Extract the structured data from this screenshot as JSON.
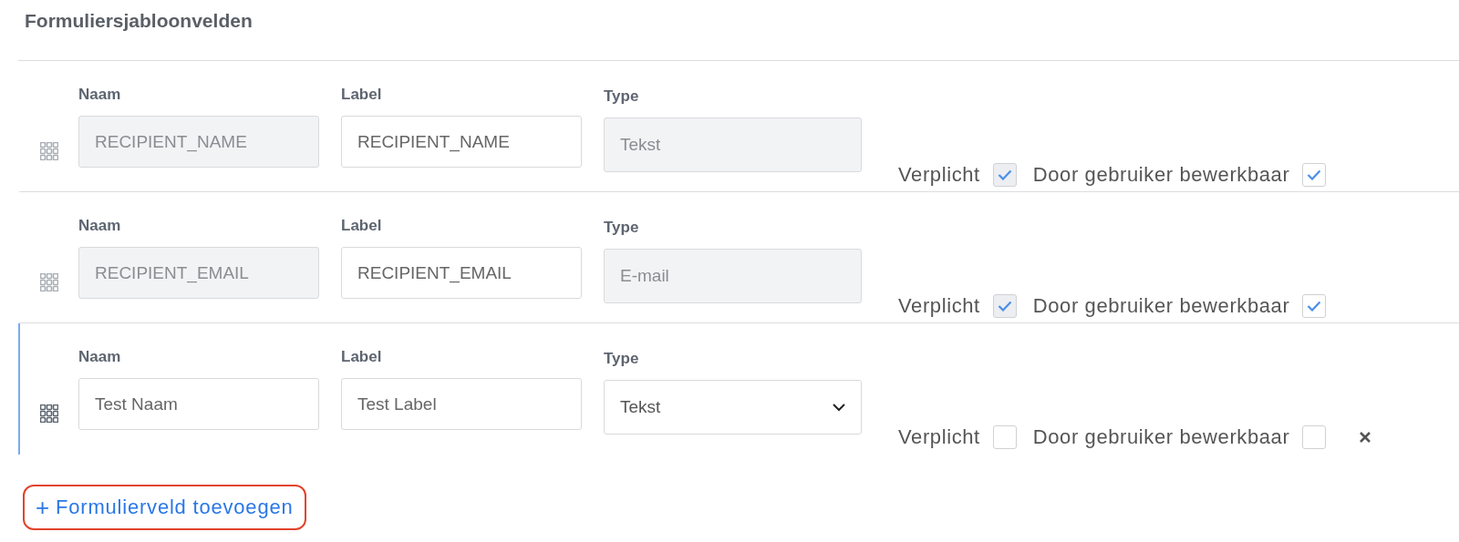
{
  "title": "Formuliersjabloonvelden",
  "rows": [
    {
      "active": false,
      "removable": false,
      "naam": {
        "label": "Naam",
        "value": "RECIPIENT_NAME",
        "disabled": true
      },
      "label": {
        "label": "Label",
        "value": "RECIPIENT_NAME"
      },
      "type": {
        "label": "Type",
        "value": "Tekst",
        "kind": "locked"
      },
      "required": {
        "label": "Verplicht",
        "checked": true,
        "disabled": true
      },
      "editable": {
        "label": "Door gebruiker bewerkbaar",
        "checked": true
      }
    },
    {
      "active": false,
      "removable": false,
      "naam": {
        "label": "Naam",
        "value": "RECIPIENT_EMAIL",
        "disabled": true
      },
      "label": {
        "label": "Label",
        "value": "RECIPIENT_EMAIL"
      },
      "type": {
        "label": "Type",
        "value": "E-mail",
        "kind": "locked"
      },
      "required": {
        "label": "Verplicht",
        "checked": true,
        "disabled": true
      },
      "editable": {
        "label": "Door gebruiker bewerkbaar",
        "checked": true
      }
    },
    {
      "active": true,
      "removable": true,
      "naam": {
        "label": "Naam",
        "value": "Test Naam",
        "disabled": false
      },
      "label": {
        "label": "Label",
        "value": "Test Label"
      },
      "type": {
        "label": "Type",
        "value": "Tekst",
        "kind": "select"
      },
      "required": {
        "label": "Verplicht",
        "checked": false,
        "disabled": false
      },
      "editable": {
        "label": "Door gebruiker bewerkbaar",
        "checked": false
      }
    }
  ],
  "add_button": {
    "icon": "+",
    "label": "Formulierveld toevoegen"
  }
}
